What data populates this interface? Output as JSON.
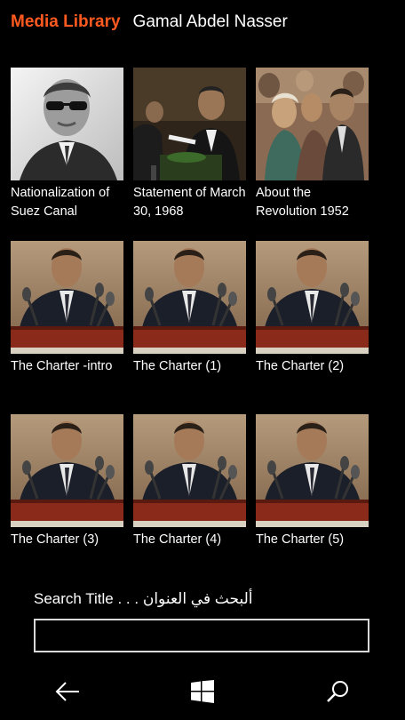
{
  "header": {
    "app_title": "Media Library",
    "page_title": "Gamal Abdel Nasser",
    "accent_color": "#ff5a1f"
  },
  "tiles": [
    {
      "caption": "Nationalization of Suez Canal",
      "thumb": "bw-portrait-sunglasses"
    },
    {
      "caption": "Statement of March 30, 1968",
      "thumb": "speech-podium-color"
    },
    {
      "caption": "About the Revolution 1952",
      "thumb": "painting-crowd"
    },
    {
      "caption": "The Charter -intro",
      "thumb": "speech-microphones"
    },
    {
      "caption": "The Charter (1)",
      "thumb": "speech-microphones"
    },
    {
      "caption": "The Charter (2)",
      "thumb": "speech-microphones"
    },
    {
      "caption": "The Charter (3)",
      "thumb": "speech-microphones"
    },
    {
      "caption": "The Charter (4)",
      "thumb": "speech-microphones"
    },
    {
      "caption": "The Charter (5)",
      "thumb": "speech-microphones"
    }
  ],
  "search": {
    "label": "Search Title  . . .  ألبحث في العنوان",
    "value": "",
    "placeholder": ""
  },
  "navbar": {
    "back_icon": "back-arrow-icon",
    "home_icon": "windows-logo-icon",
    "search_icon": "search-icon"
  }
}
